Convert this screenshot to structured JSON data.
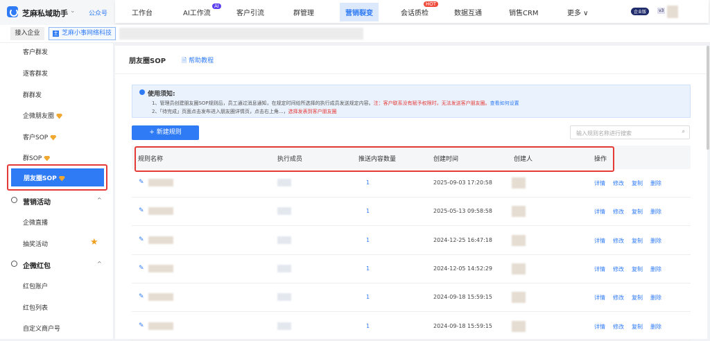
{
  "header": {
    "brand": "芝麻私域助手",
    "account_type": "公众号",
    "edition_badge": "企业版",
    "version": "v3",
    "nav": [
      {
        "label": "工作台"
      },
      {
        "label": "AI工作流",
        "badge": "AI"
      },
      {
        "label": "客户引流"
      },
      {
        "label": "群管理"
      },
      {
        "label": "营销裂变",
        "active": true
      },
      {
        "label": "会话质检",
        "badge": "HOT"
      },
      {
        "label": "数据互通"
      },
      {
        "label": "销售CRM"
      },
      {
        "label": "更多 ∨"
      }
    ]
  },
  "subbar": {
    "join": "接入企业",
    "corp": "芝麻小事网络科技",
    "corp_icon": "主"
  },
  "sidebar": {
    "items": [
      "客户群发",
      "逐客群发",
      "群群发",
      "企微朋友圈",
      "客户SOP",
      "群SOP"
    ],
    "active": "朋友圈SOP",
    "sections": [
      {
        "title": "营销活动",
        "items": [
          "企微直播",
          "抽奖活动"
        ]
      },
      {
        "title": "企微红包",
        "items": [
          "红包账户",
          "红包列表",
          "自定义商户号"
        ]
      }
    ]
  },
  "main": {
    "title": "朋友圈SOP",
    "help": "帮助教程",
    "notice": {
      "title": "使用须知:",
      "line1": "1、管理员创建朋友圈SOP规则后，员工通过消息通知，在规定时间给所选择的执行成员发送规定内容。",
      "line1_warn": "注：客户联系没有赋予权限时，无法发送客户朋友圈。",
      "line1_link": "查看如何设置",
      "line2": "2、「待完成」页面点击发布进入朋友圈详情页，点击右上角...，",
      "line2_warn": "选择发表到客户朋友圈"
    },
    "new_button": "新建规则",
    "search_placeholder": "输入规则名称进行搜索",
    "columns": [
      "规则名称",
      "执行成员",
      "推送内容数量",
      "创建时间",
      "创建人",
      "操作"
    ],
    "actions": [
      "详情",
      "修改",
      "复制",
      "删除"
    ],
    "rows": [
      {
        "count": "1",
        "created": "2025-09-03 17:20:58"
      },
      {
        "count": "1",
        "created": "2025-05-13 09:58:58"
      },
      {
        "count": "1",
        "created": "2024-12-25 16:47:18"
      },
      {
        "count": "1",
        "created": "2024-12-05 14:52:29"
      },
      {
        "count": "1",
        "created": "2024-09-18 15:59:15"
      },
      {
        "count": "1",
        "created": "2024-09-18 15:59:15"
      }
    ]
  },
  "colors": {
    "primary": "#2f7bf6",
    "warn": "#e53935"
  }
}
